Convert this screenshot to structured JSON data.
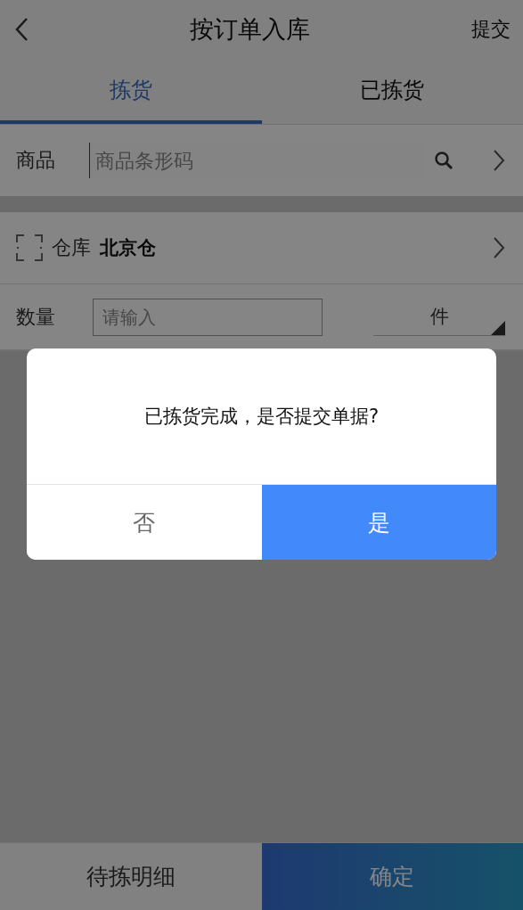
{
  "header": {
    "title": "按订单入库",
    "action": "提交"
  },
  "tabs": [
    {
      "label": "拣货",
      "selected": true
    },
    {
      "label": "已拣货",
      "selected": false
    }
  ],
  "product": {
    "label": "商品",
    "placeholder": "商品条形码"
  },
  "warehouse": {
    "label": "仓库",
    "value": "北京仓"
  },
  "quantity": {
    "label": "数量",
    "placeholder": "请输入",
    "unit": "件"
  },
  "footer": {
    "buttons": [
      {
        "label": "待拣明细",
        "kind": "secondary"
      },
      {
        "label": "确定",
        "kind": "primary"
      }
    ]
  },
  "dialog": {
    "message": "已拣货完成，是否提交单据?",
    "buttons": [
      {
        "label": "否",
        "kind": "cancel"
      },
      {
        "label": "是",
        "kind": "confirm"
      }
    ]
  }
}
